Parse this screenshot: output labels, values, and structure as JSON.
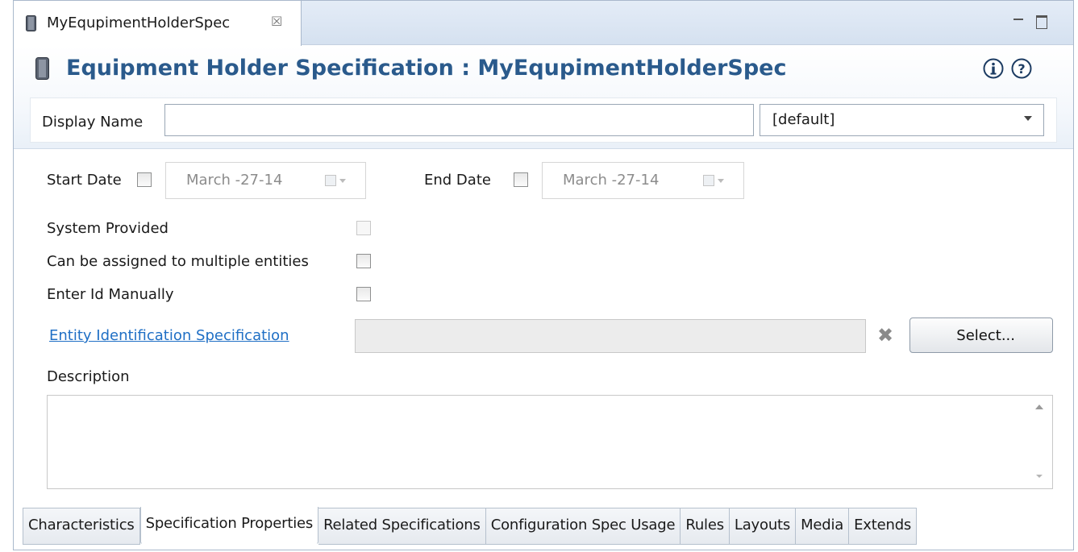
{
  "tab": {
    "title": "MyEqupimentHolderSpec",
    "close_glyph": "☒"
  },
  "header": {
    "title": "Equipment Holder Specification : MyEqupimentHolderSpec",
    "info_glyph": "ⓘ",
    "help_glyph": "?"
  },
  "display_name": {
    "label": "Display Name",
    "value": "",
    "locale": "[default]"
  },
  "dates": {
    "start_label": "Start Date",
    "start_value": "March   -27-14",
    "end_label": "End Date",
    "end_value": "March   -27-14"
  },
  "flags": {
    "system_provided": "System Provided",
    "multiple_entities": "Can be assigned to multiple entities",
    "enter_id_manually": "Enter Id Manually"
  },
  "entity_spec": {
    "link": "Entity Identification Specification",
    "value": "",
    "clear_glyph": "✖",
    "select_label": "Select..."
  },
  "description": {
    "label": "Description",
    "value": ""
  },
  "bottom_tabs": [
    {
      "label": "Characteristics"
    },
    {
      "label": "Specification Properties"
    },
    {
      "label": "Related Specifications"
    },
    {
      "label": "Configuration Spec Usage"
    },
    {
      "label": "Rules"
    },
    {
      "label": "Layouts"
    },
    {
      "label": "Media"
    },
    {
      "label": "Extends"
    }
  ],
  "active_tab": "Specification Properties",
  "colors": {
    "title": "#2a5a8c",
    "link": "#1f6fc5"
  }
}
